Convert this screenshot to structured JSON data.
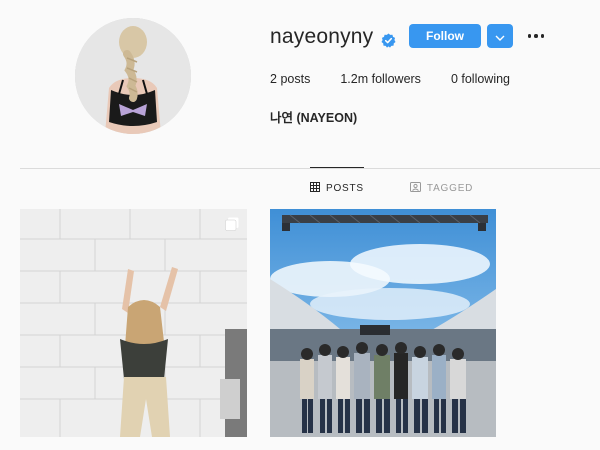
{
  "profile": {
    "username": "nayeonyny",
    "full_name": "나연 (NAYEON)",
    "verified_icon": "verified-badge-icon"
  },
  "actions": {
    "follow_label": "Follow",
    "dropdown_icon": "chevron-down-icon",
    "more_icon": "more-options-icon"
  },
  "stats": {
    "posts_count": "2",
    "posts_label": "posts",
    "followers_count": "1.2m",
    "followers_label": "followers",
    "following_count": "0",
    "following_label": "following"
  },
  "tabs": [
    {
      "label": "POSTS",
      "icon": "grid-icon",
      "active": true
    },
    {
      "label": "TAGGED",
      "icon": "tagged-icon",
      "active": false
    }
  ],
  "colors": {
    "accent": "#3897f0",
    "background": "#fafafa",
    "text": "#262626",
    "muted": "#999999"
  }
}
